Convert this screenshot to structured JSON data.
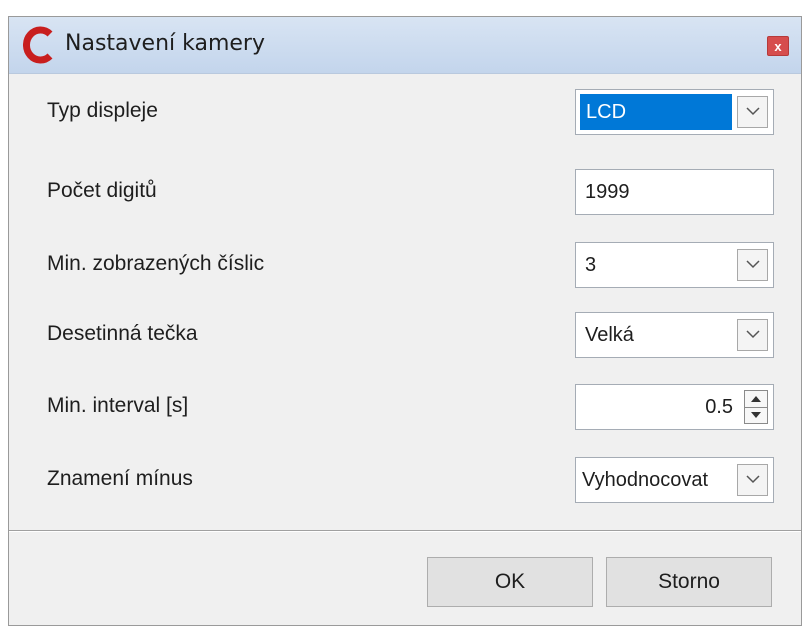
{
  "window": {
    "title": "Nastavení kamery",
    "close_label": "x"
  },
  "fields": [
    {
      "label": "Typ displeje",
      "value": "LCD",
      "control": "dropdown",
      "selected": true
    },
    {
      "label": "Počet digitů",
      "value": "1999",
      "control": "text"
    },
    {
      "label": "Min. zobrazených číslic",
      "value": "3",
      "control": "dropdown"
    },
    {
      "label": "Desetinná tečka",
      "value": "Velká",
      "control": "dropdown"
    },
    {
      "label": "Min. interval [s]",
      "value": "0.5",
      "control": "spinner"
    },
    {
      "label": "Znamení mínus",
      "value": "Vyhodnocovat",
      "control": "dropdown"
    }
  ],
  "buttons": {
    "ok_label": "OK",
    "cancel_label": "Storno"
  },
  "icons": {
    "logo": "app-logo-icon",
    "close": "close-icon",
    "dropdown": "chevron-down-icon",
    "spinner": "spinner-arrows-icon"
  },
  "colors": {
    "titlebar": "#c9d9ee",
    "selection": "#0078d7",
    "close_button": "#d64d4d",
    "logo": "#c81e1e"
  }
}
